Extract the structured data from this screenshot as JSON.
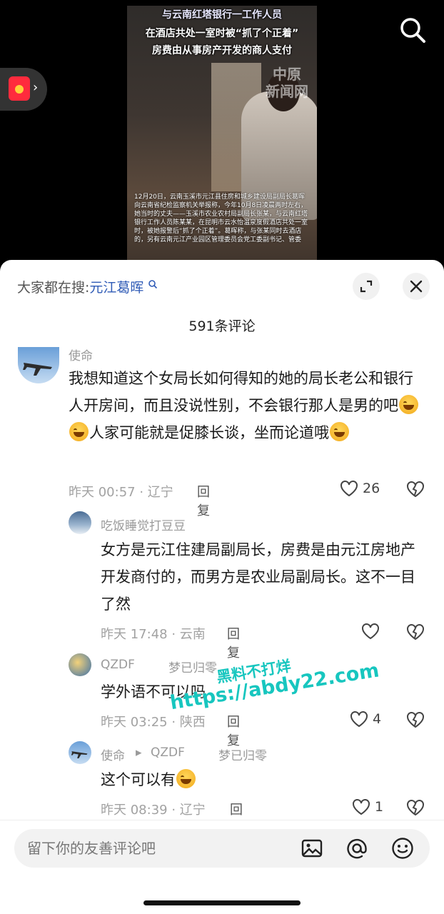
{
  "video": {
    "headline_1": "与云南红塔银行一工作人员",
    "headline_2": "在酒店共处一室时被“抓了个正着”",
    "headline_3": "房费由从事房产开发的商人支付",
    "brand_line_1": "中原",
    "brand_line_2": "新闻网",
    "caption": "12月20日，云南玉溪市元江县住房和城乡建设局副局长葛晖向云南省纪检监察机关举报称，今年10月8日凌晨两时左右，她当时的丈夫——玉溪市农业农村局副局长张某，与云南红塔银行工作人员陈某某，在昆明市云水怡温泉度假酒店共处一室时，被她报警后“抓了个正着”。葛晖称，与张某同时去酒店的，另有云南元江产业园区管理委员会党工委副书记、管委"
  },
  "sheet": {
    "search_label": "大家都在搜:",
    "search_keyword": "元江葛晖",
    "comment_count": "591条评论"
  },
  "comments": [
    {
      "author": "使命",
      "text_a": "我想知道这个女局长如何得知的她的局长老公和银行人开房间，而且没说性别，不会银行那人是男的吧",
      "text_b": "人家可能就是促膝长谈，坐而论道哦",
      "meta": "昨天 00:57 · 辽宁",
      "reply_label": "回复",
      "likes": "26"
    },
    {
      "author": "吃饭睡觉打豆豆",
      "text": "女方是元江住建局副局长，房费是由元江房地产开发商付的，而男方是农业局副局长。这不一目了然",
      "meta": "昨天 17:48 · 云南",
      "reply_label": "回复"
    },
    {
      "author": "QZDF",
      "author_alt": "梦已归零",
      "text": "学外语不可以吗",
      "meta": "昨天 03:25 · 陕西",
      "reply_label": "回复",
      "likes": "4"
    },
    {
      "author": "使命",
      "reply_to": "QZDF",
      "author_alt": "梦已归零",
      "text": "这个可以有",
      "meta": "昨天 08:39 · 辽宁",
      "reply_label": "回复",
      "likes": "1"
    }
  ],
  "watermark": {
    "line_1": "黑料不打烊",
    "line_2": "https://abdy22.com"
  },
  "input": {
    "placeholder": "留下你的友善评论吧"
  },
  "colors": {
    "keyword": "#2f5bb6",
    "watermark": "#17c6bf",
    "red_packet": "#ff2b3d"
  }
}
